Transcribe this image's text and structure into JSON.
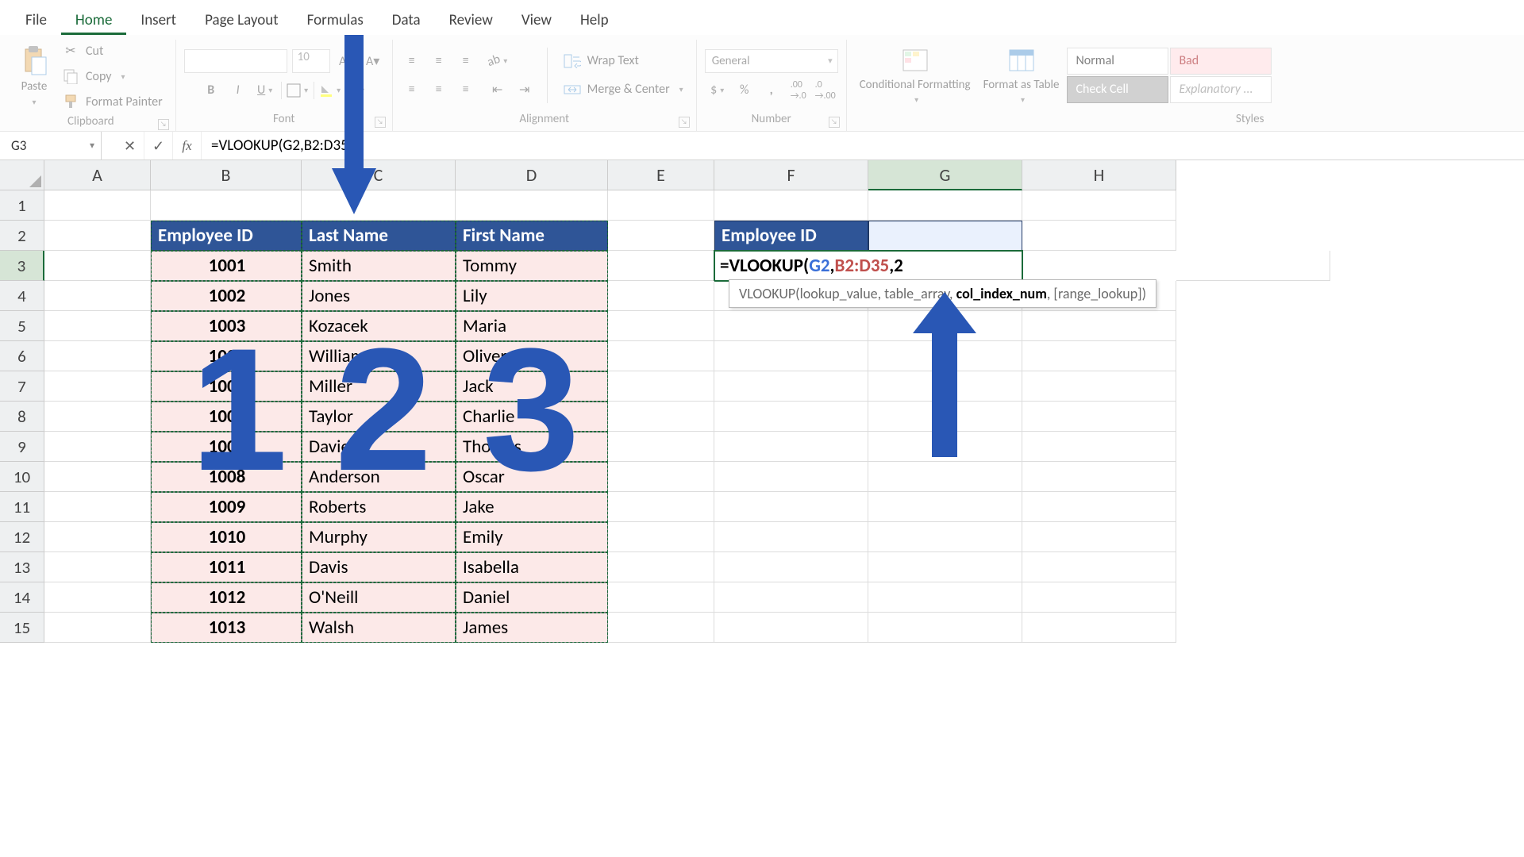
{
  "ribbon": {
    "tabs": [
      "File",
      "Home",
      "Insert",
      "Page Layout",
      "Formulas",
      "Data",
      "Review",
      "View",
      "Help"
    ],
    "active_tab": 1,
    "clipboard": {
      "paste": "Paste",
      "cut": "Cut",
      "copy": "Copy",
      "fmtpaint": "Format Painter",
      "label": "Clipboard"
    },
    "font": {
      "name": "",
      "size": "10",
      "label": "Font"
    },
    "alignment": {
      "wrap": "Wrap Text",
      "merge": "Merge & Center",
      "label": "Alignment"
    },
    "number": {
      "format": "General",
      "label": "Number"
    },
    "styles": {
      "cond": "Conditional Formatting",
      "fat": "Format as Table",
      "normal": "Normal",
      "bad": "Bad",
      "check": "Check Cell",
      "expl": "Explanatory ...",
      "label": "Styles"
    }
  },
  "formulabar": {
    "name": "G3",
    "cancel": "✕",
    "enter": "✓",
    "formula": "=VLOOKUP(G2,B2:D35,2"
  },
  "colwidths": {
    "A": 134,
    "B": 190,
    "C": 194,
    "D": 192,
    "E": 134,
    "F": 194,
    "G": 194,
    "H": 194
  },
  "cols": [
    "A",
    "B",
    "C",
    "D",
    "E",
    "F",
    "G",
    "H"
  ],
  "rows": [
    1,
    2,
    3,
    4,
    5,
    6,
    7,
    8,
    9,
    10,
    11,
    12,
    13,
    14,
    15
  ],
  "selected_col": "G",
  "selected_row": 3,
  "table_left": {
    "headers": [
      "Employee ID",
      "Last Name",
      "First Name"
    ],
    "rows": [
      [
        "1001",
        "Smith",
        "Tommy"
      ],
      [
        "1002",
        "Jones",
        "Lily"
      ],
      [
        "1003",
        "Kozacek",
        "Maria"
      ],
      [
        "1004",
        "Williams",
        "Oliver"
      ],
      [
        "1005",
        "Miller",
        "Jack"
      ],
      [
        "1006",
        "Taylor",
        "Charlie"
      ],
      [
        "1007",
        "Davies",
        "Thomas"
      ],
      [
        "1008",
        "Anderson",
        "Oscar"
      ],
      [
        "1009",
        "Roberts",
        "Jake"
      ],
      [
        "1010",
        "Murphy",
        "Emily"
      ],
      [
        "1011",
        "Davis",
        "Isabella"
      ],
      [
        "1012",
        "O'Neill",
        "Daniel"
      ],
      [
        "1013",
        "Walsh",
        "James"
      ]
    ]
  },
  "lookup": {
    "header": "Employee ID",
    "formula_parts": {
      "pre": "=VLOOKUP(",
      "a1": "G2",
      "c1": ",",
      "a2": "B2:D35",
      "c2": ",",
      "a3": "2"
    },
    "tooltip_pre": "VLOOKUP(lookup_value, table_array, ",
    "tooltip_bold": "col_index_num",
    "tooltip_post": ", [range_lookup])"
  },
  "overlay_nums": [
    "1",
    "2",
    "3"
  ]
}
